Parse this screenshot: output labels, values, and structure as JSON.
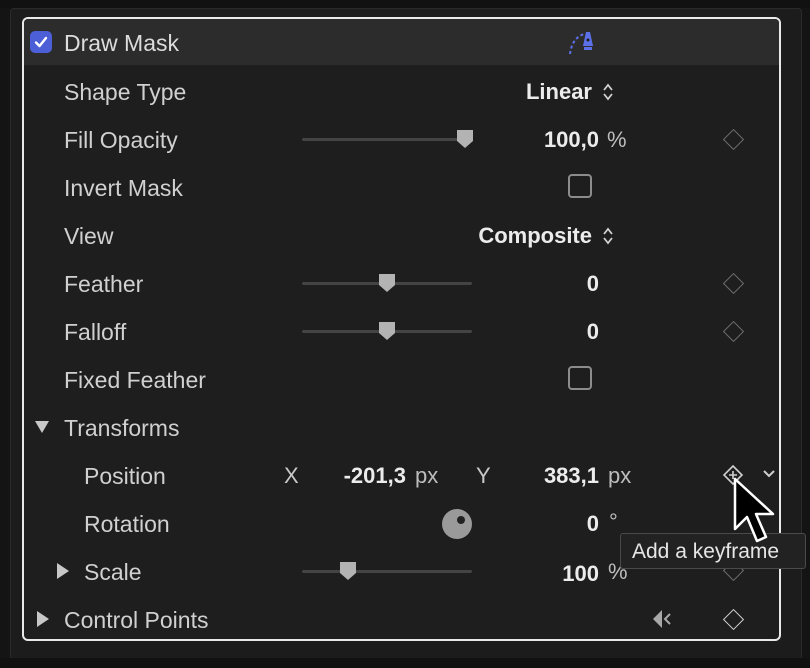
{
  "header": {
    "title": "Draw Mask",
    "enabled": true,
    "icon": "pen-mask-icon",
    "accent": "#4d5fd6"
  },
  "rows": {
    "shape_type": {
      "label": "Shape Type",
      "value": "Linear"
    },
    "fill_opacity": {
      "label": "Fill Opacity",
      "value": "100,0",
      "unit": "%",
      "slider_level": 1.0
    },
    "invert_mask": {
      "label": "Invert Mask",
      "checked": false
    },
    "view": {
      "label": "View",
      "value": "Composite"
    },
    "feather": {
      "label": "Feather",
      "value": "0",
      "slider_level": 0.5
    },
    "falloff": {
      "label": "Falloff",
      "value": "0",
      "slider_level": 0.5
    },
    "fixed_feather": {
      "label": "Fixed Feather",
      "checked": false
    },
    "transforms": {
      "label": "Transforms",
      "expanded": true
    },
    "position": {
      "label": "Position",
      "x_label": "X",
      "x_value": "-201,3",
      "x_unit": "px",
      "y_label": "Y",
      "y_value": "383,1",
      "y_unit": "px"
    },
    "rotation": {
      "label": "Rotation",
      "value": "0",
      "unit": "°"
    },
    "scale": {
      "label": "Scale",
      "value": "100",
      "unit": "%",
      "slider_level": 0.27,
      "expanded": false
    },
    "control_points": {
      "label": "Control Points",
      "expanded": false
    }
  },
  "tooltip": {
    "text": "Add a keyframe"
  }
}
